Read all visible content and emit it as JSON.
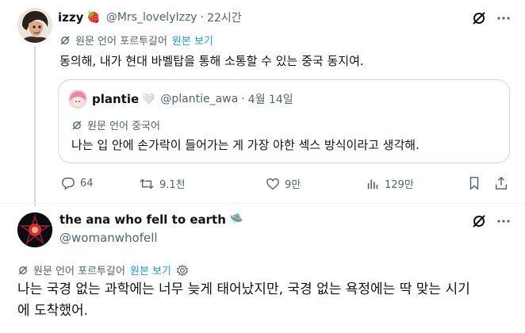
{
  "tweet1": {
    "display_name": "izzy",
    "name_emoji": "🍓",
    "handle": "@Mrs_lovelyIzzy",
    "separator": "·",
    "time": "22시간",
    "translate_label": "원문 언어 포르투갈어",
    "translate_link": "원본 보기",
    "text": "동의해, 내가 현대 바벨탑을 통해 소통할 수 있는 중국 동지여.",
    "quote": {
      "display_name": "plantie",
      "name_emoji": "🤍",
      "handle": "@plantie_awa",
      "separator": "·",
      "date": "4월 14일",
      "translate_label": "원문 언어 중국어",
      "text": "나는 입 안에 손가락이 들어가는 게 가장 야한 섹스 방식이라고 생각해."
    },
    "actions": {
      "replies": "64",
      "retweets": "9.1천",
      "likes": "9만",
      "views": "129만"
    }
  },
  "tweet2": {
    "display_name": "the ana who fell to earth",
    "name_emoji": "🛸",
    "handle": "@womanwhofell",
    "translate_label": "원문 언어 포르투갈어",
    "translate_link": "원본 보기",
    "text_line1": "나는 국경 없는 과학에는 너무 늦게 태어났지만, 국경 없는 욕정에는 딱 맞는 시기",
    "text_line2": "에 도착했어."
  },
  "colors": {
    "text": "#0f1419",
    "muted": "#536471",
    "link": "#1d9bf0",
    "border": "#cfd9de"
  }
}
